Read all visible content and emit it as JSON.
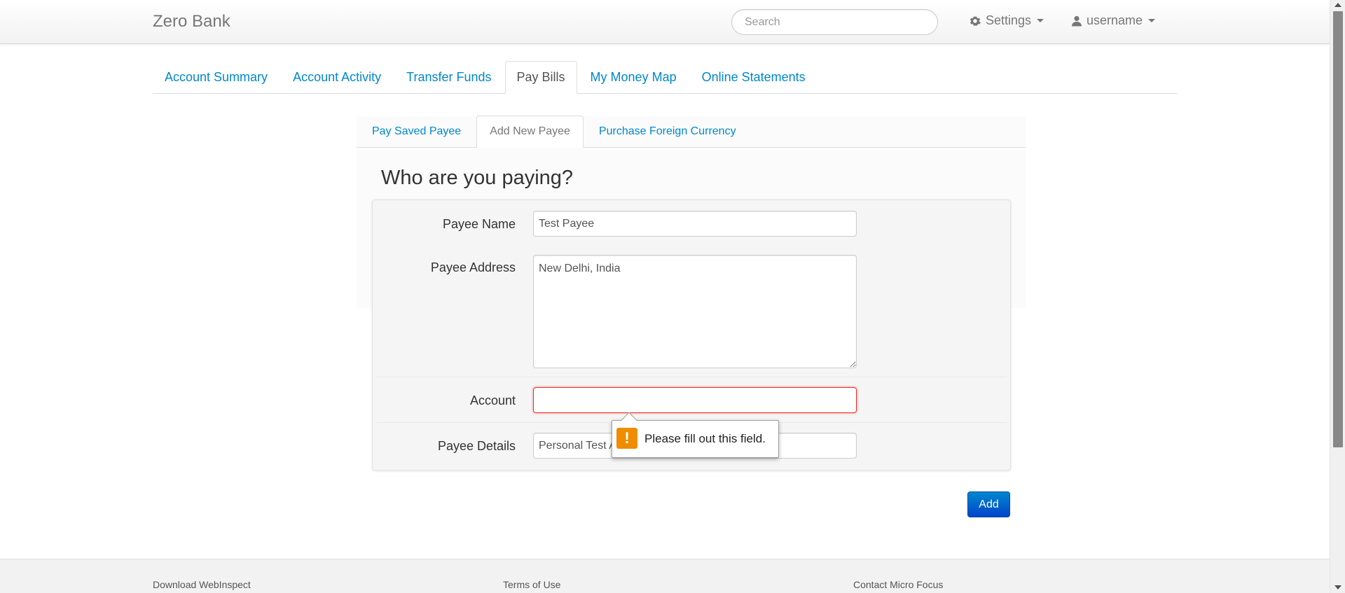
{
  "navbar": {
    "brand": "Zero Bank",
    "search_placeholder": "Search",
    "settings_label": "Settings",
    "user_label": "username"
  },
  "main_tabs": [
    {
      "label": "Account Summary",
      "active": false
    },
    {
      "label": "Account Activity",
      "active": false
    },
    {
      "label": "Transfer Funds",
      "active": false
    },
    {
      "label": "Pay Bills",
      "active": true
    },
    {
      "label": "My Money Map",
      "active": false
    },
    {
      "label": "Online Statements",
      "active": false
    }
  ],
  "sub_tabs": [
    {
      "label": "Pay Saved Payee",
      "active": false
    },
    {
      "label": "Add New Payee",
      "active": true
    },
    {
      "label": "Purchase Foreign Currency",
      "active": false
    }
  ],
  "form": {
    "heading": "Who are you paying?",
    "payee_name_label": "Payee Name",
    "payee_name_value": "Test Payee",
    "payee_address_label": "Payee Address",
    "payee_address_value": "New Delhi, India",
    "account_label": "Account",
    "account_value": "",
    "payee_details_label": "Payee Details",
    "payee_details_value": "Personal Test Account",
    "add_button": "Add"
  },
  "validation": {
    "message": "Please fill out this field.",
    "icon": "!"
  },
  "footer": {
    "links": [
      "Download WebInspect",
      "Terms of Use",
      "Contact Micro Focus"
    ]
  },
  "colors": {
    "link": "#0088cc",
    "primary_button": "#0055cc",
    "error_border": "#e9322d",
    "warning_icon": "#f08c00"
  }
}
